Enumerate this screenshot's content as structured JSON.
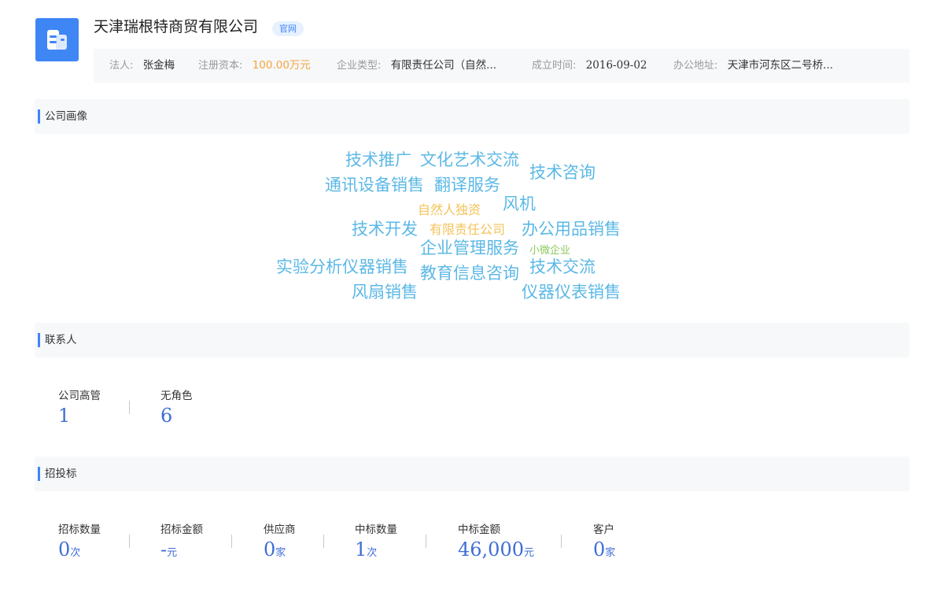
{
  "company": {
    "name": "天津瑞根特商贸有限公司",
    "website_badge": "官网",
    "logo_icon": "building-icon",
    "accent_color": "#3f86f5"
  },
  "info": [
    {
      "label": "法人:",
      "value": "张金梅"
    },
    {
      "label": "注册资本:",
      "value": "100.00万元"
    },
    {
      "label": "企业类型:",
      "value": "有限责任公司（自然..."
    },
    {
      "label": "成立时间:",
      "value": "2016-09-02"
    },
    {
      "label": "办公地址:",
      "value": "天津市河东区二号桥..."
    }
  ],
  "sections": {
    "portrait": "公司画像",
    "contacts": "联系人",
    "bidding": "招投标"
  },
  "word_cloud": [
    {
      "text": "技术推广",
      "color": "#5cb8e6"
    },
    {
      "text": "文化艺术交流",
      "color": "#5cb8e6"
    },
    {
      "text": "技术咨询",
      "color": "#5cb8e6"
    },
    {
      "text": "通讯设备销售",
      "color": "#5cb8e6"
    },
    {
      "text": "翻译服务",
      "color": "#5cb8e6"
    },
    {
      "text": "自然人独资",
      "color": "#f4c35a"
    },
    {
      "text": "风机",
      "color": "#5cb8e6"
    },
    {
      "text": "技术开发",
      "color": "#5cb8e6"
    },
    {
      "text": "有限责任公司",
      "color": "#f4c35a"
    },
    {
      "text": "办公用品销售",
      "color": "#5cb8e6"
    },
    {
      "text": "企业管理服务",
      "color": "#5cb8e6"
    },
    {
      "text": "小微企业",
      "color": "#8cc85a"
    },
    {
      "text": "实验分析仪器销售",
      "color": "#5cb8e6"
    },
    {
      "text": "教育信息咨询",
      "color": "#5cb8e6"
    },
    {
      "text": "技术交流",
      "color": "#5cb8e6"
    },
    {
      "text": "风扇销售",
      "color": "#5cb8e6"
    },
    {
      "text": "仪器仪表销售",
      "color": "#5cb8e6"
    }
  ],
  "contacts": [
    {
      "label": "公司高管",
      "value": "1",
      "unit": ""
    },
    {
      "label": "无角色",
      "value": "6",
      "unit": ""
    }
  ],
  "bidding": [
    {
      "label": "招标数量",
      "value": "0",
      "unit": "次"
    },
    {
      "label": "招标金额",
      "value": "-",
      "unit": "元"
    },
    {
      "label": "供应商",
      "value": "0",
      "unit": "家"
    },
    {
      "label": "中标数量",
      "value": "1",
      "unit": "次"
    },
    {
      "label": "中标金额",
      "value": "46,000",
      "unit": "元"
    },
    {
      "label": "客户",
      "value": "0",
      "unit": "家"
    }
  ]
}
